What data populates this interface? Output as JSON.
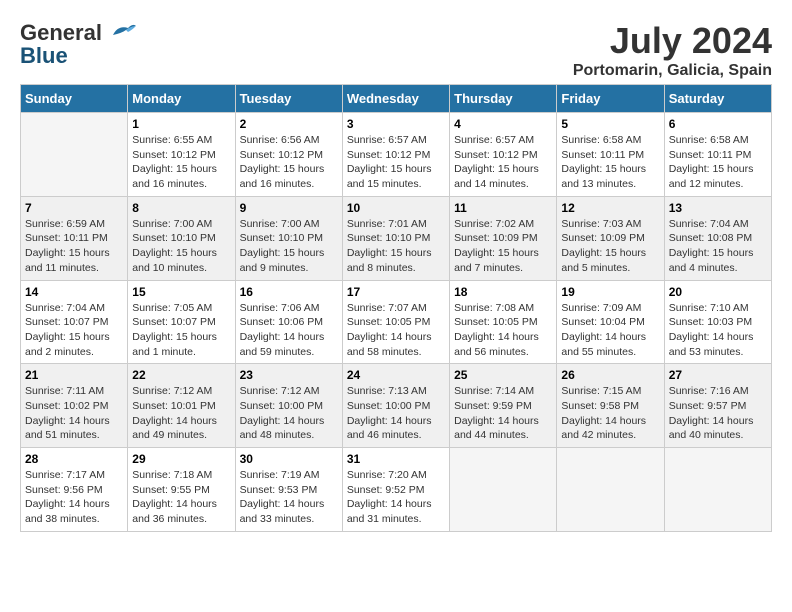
{
  "header": {
    "logo_general": "General",
    "logo_blue": "Blue",
    "title": "July 2024",
    "location": "Portomarin, Galicia, Spain"
  },
  "columns": [
    "Sunday",
    "Monday",
    "Tuesday",
    "Wednesday",
    "Thursday",
    "Friday",
    "Saturday"
  ],
  "weeks": [
    [
      {
        "day": "",
        "info": ""
      },
      {
        "day": "1",
        "info": "Sunrise: 6:55 AM\nSunset: 10:12 PM\nDaylight: 15 hours\nand 16 minutes."
      },
      {
        "day": "2",
        "info": "Sunrise: 6:56 AM\nSunset: 10:12 PM\nDaylight: 15 hours\nand 16 minutes."
      },
      {
        "day": "3",
        "info": "Sunrise: 6:57 AM\nSunset: 10:12 PM\nDaylight: 15 hours\nand 15 minutes."
      },
      {
        "day": "4",
        "info": "Sunrise: 6:57 AM\nSunset: 10:12 PM\nDaylight: 15 hours\nand 14 minutes."
      },
      {
        "day": "5",
        "info": "Sunrise: 6:58 AM\nSunset: 10:11 PM\nDaylight: 15 hours\nand 13 minutes."
      },
      {
        "day": "6",
        "info": "Sunrise: 6:58 AM\nSunset: 10:11 PM\nDaylight: 15 hours\nand 12 minutes."
      }
    ],
    [
      {
        "day": "7",
        "info": "Sunrise: 6:59 AM\nSunset: 10:11 PM\nDaylight: 15 hours\nand 11 minutes."
      },
      {
        "day": "8",
        "info": "Sunrise: 7:00 AM\nSunset: 10:10 PM\nDaylight: 15 hours\nand 10 minutes."
      },
      {
        "day": "9",
        "info": "Sunrise: 7:00 AM\nSunset: 10:10 PM\nDaylight: 15 hours\nand 9 minutes."
      },
      {
        "day": "10",
        "info": "Sunrise: 7:01 AM\nSunset: 10:10 PM\nDaylight: 15 hours\nand 8 minutes."
      },
      {
        "day": "11",
        "info": "Sunrise: 7:02 AM\nSunset: 10:09 PM\nDaylight: 15 hours\nand 7 minutes."
      },
      {
        "day": "12",
        "info": "Sunrise: 7:03 AM\nSunset: 10:09 PM\nDaylight: 15 hours\nand 5 minutes."
      },
      {
        "day": "13",
        "info": "Sunrise: 7:04 AM\nSunset: 10:08 PM\nDaylight: 15 hours\nand 4 minutes."
      }
    ],
    [
      {
        "day": "14",
        "info": "Sunrise: 7:04 AM\nSunset: 10:07 PM\nDaylight: 15 hours\nand 2 minutes."
      },
      {
        "day": "15",
        "info": "Sunrise: 7:05 AM\nSunset: 10:07 PM\nDaylight: 15 hours\nand 1 minute."
      },
      {
        "day": "16",
        "info": "Sunrise: 7:06 AM\nSunset: 10:06 PM\nDaylight: 14 hours\nand 59 minutes."
      },
      {
        "day": "17",
        "info": "Sunrise: 7:07 AM\nSunset: 10:05 PM\nDaylight: 14 hours\nand 58 minutes."
      },
      {
        "day": "18",
        "info": "Sunrise: 7:08 AM\nSunset: 10:05 PM\nDaylight: 14 hours\nand 56 minutes."
      },
      {
        "day": "19",
        "info": "Sunrise: 7:09 AM\nSunset: 10:04 PM\nDaylight: 14 hours\nand 55 minutes."
      },
      {
        "day": "20",
        "info": "Sunrise: 7:10 AM\nSunset: 10:03 PM\nDaylight: 14 hours\nand 53 minutes."
      }
    ],
    [
      {
        "day": "21",
        "info": "Sunrise: 7:11 AM\nSunset: 10:02 PM\nDaylight: 14 hours\nand 51 minutes."
      },
      {
        "day": "22",
        "info": "Sunrise: 7:12 AM\nSunset: 10:01 PM\nDaylight: 14 hours\nand 49 minutes."
      },
      {
        "day": "23",
        "info": "Sunrise: 7:12 AM\nSunset: 10:00 PM\nDaylight: 14 hours\nand 48 minutes."
      },
      {
        "day": "24",
        "info": "Sunrise: 7:13 AM\nSunset: 10:00 PM\nDaylight: 14 hours\nand 46 minutes."
      },
      {
        "day": "25",
        "info": "Sunrise: 7:14 AM\nSunset: 9:59 PM\nDaylight: 14 hours\nand 44 minutes."
      },
      {
        "day": "26",
        "info": "Sunrise: 7:15 AM\nSunset: 9:58 PM\nDaylight: 14 hours\nand 42 minutes."
      },
      {
        "day": "27",
        "info": "Sunrise: 7:16 AM\nSunset: 9:57 PM\nDaylight: 14 hours\nand 40 minutes."
      }
    ],
    [
      {
        "day": "28",
        "info": "Sunrise: 7:17 AM\nSunset: 9:56 PM\nDaylight: 14 hours\nand 38 minutes."
      },
      {
        "day": "29",
        "info": "Sunrise: 7:18 AM\nSunset: 9:55 PM\nDaylight: 14 hours\nand 36 minutes."
      },
      {
        "day": "30",
        "info": "Sunrise: 7:19 AM\nSunset: 9:53 PM\nDaylight: 14 hours\nand 33 minutes."
      },
      {
        "day": "31",
        "info": "Sunrise: 7:20 AM\nSunset: 9:52 PM\nDaylight: 14 hours\nand 31 minutes."
      },
      {
        "day": "",
        "info": ""
      },
      {
        "day": "",
        "info": ""
      },
      {
        "day": "",
        "info": ""
      }
    ]
  ]
}
